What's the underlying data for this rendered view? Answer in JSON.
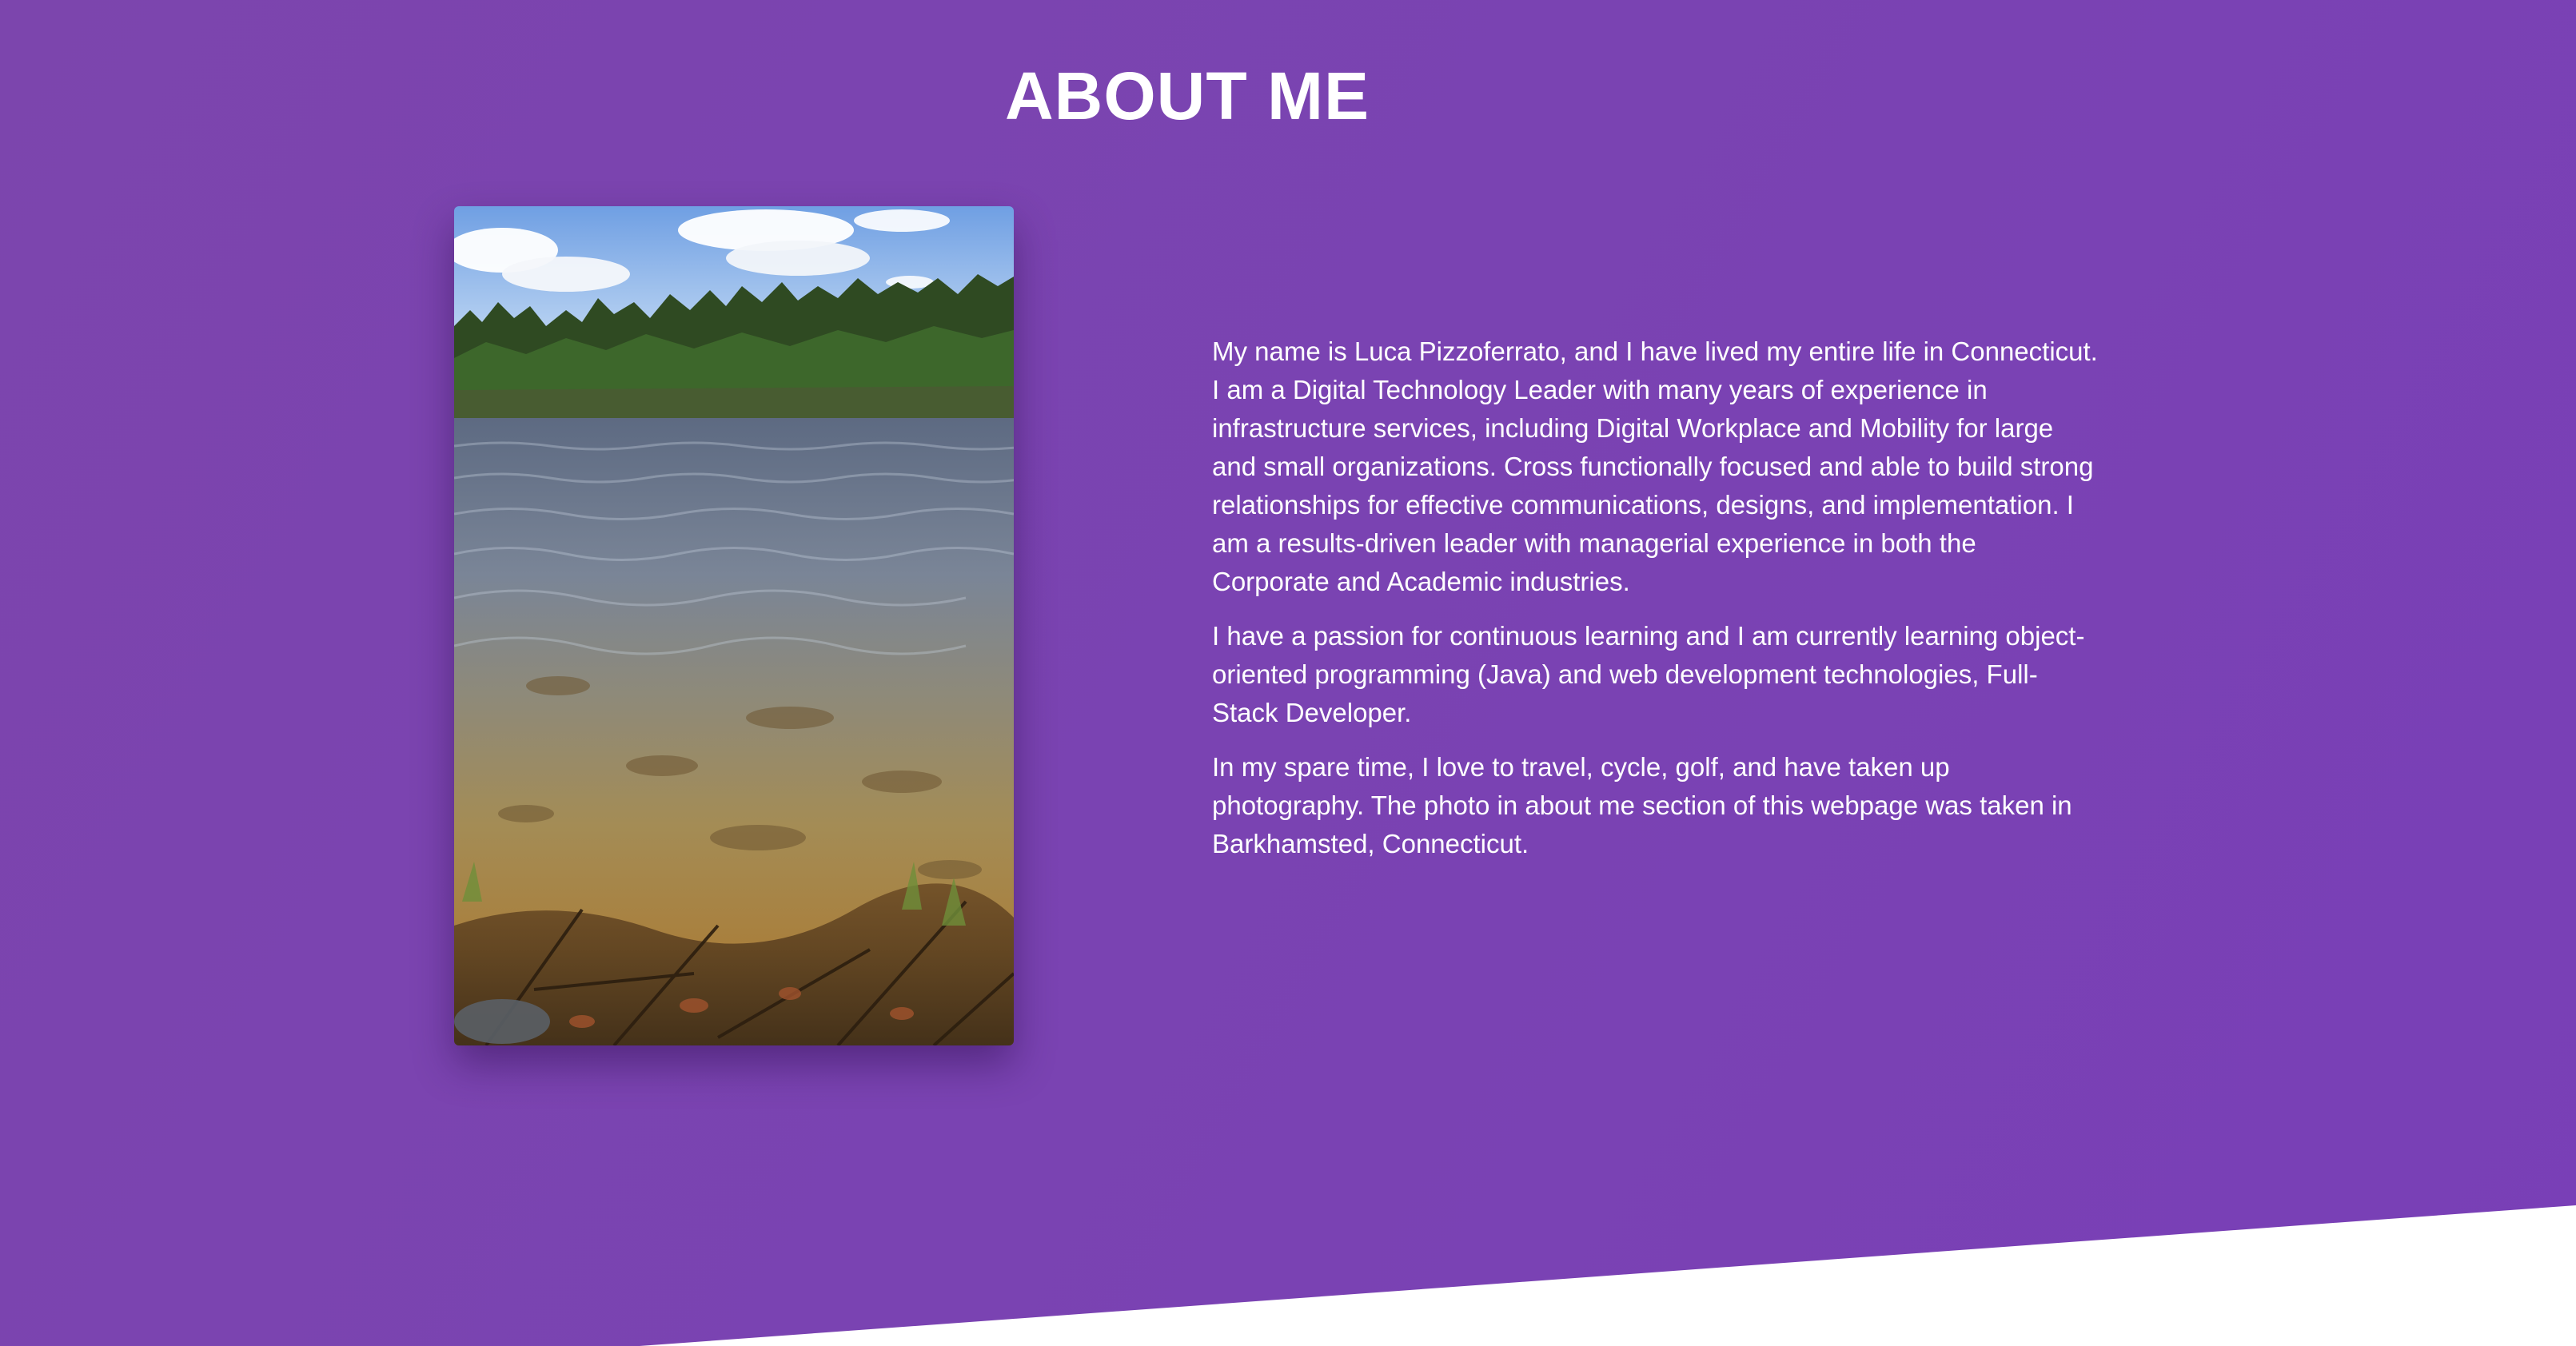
{
  "about": {
    "title": "ABOUT ME",
    "photo_subject": "lake-shoreline-photo",
    "paragraphs": [
      "My name is Luca Pizzoferrato, and I have lived my entire life in Connecticut. I am a Digital Technology Leader with many years of experience in infrastructure services, including Digital Workplace and Mobility for large and small organizations. Cross functionally focused and able to build strong relationships for effective communications, designs, and implementation. I am a results-driven leader with managerial experience in both the Corporate and Academic industries.",
      "I have a passion for continuous learning and I am currently learning object-oriented programming (Java) and web development technologies, Full-Stack Developer.",
      "In my spare time, I love to travel, cycle, golf, and have taken up photography. The photo in about me section of this webpage was taken in Barkhamsted, Connecticut."
    ]
  },
  "colors": {
    "section_background": "#7a43b2",
    "text": "#ffffff",
    "page_background": "#ffffff"
  }
}
